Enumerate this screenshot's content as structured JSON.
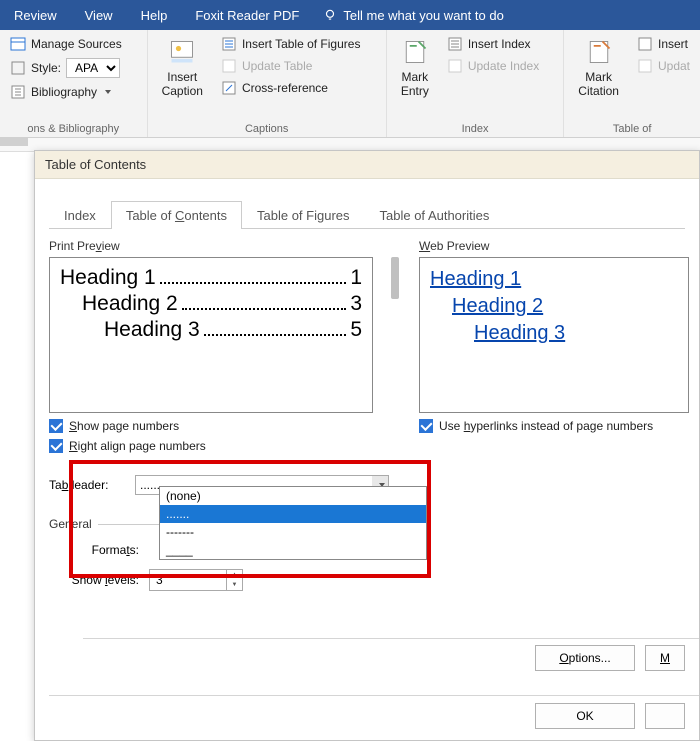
{
  "menu": {
    "review": "Review",
    "view": "View",
    "help": "Help",
    "foxit": "Foxit Reader PDF",
    "tell_me": "Tell me what you want to do"
  },
  "ribbon": {
    "group_cit_bib": {
      "manage_sources": "Manage Sources",
      "style_label": "Style:",
      "style_value": "APA",
      "bibliography": "Bibliography",
      "label": "ons & Bibliography"
    },
    "group_captions": {
      "insert_caption": "Insert\nCaption",
      "insert_tof": "Insert Table of Figures",
      "update_table": "Update Table",
      "cross_reference": "Cross-reference",
      "label": "Captions"
    },
    "group_index": {
      "mark_entry": "Mark\nEntry",
      "insert_index": "Insert Index",
      "update_index": "Update Index",
      "label": "Index"
    },
    "group_toa": {
      "mark_citation": "Mark\nCitation",
      "insert": "Insert",
      "updat": "Updat",
      "label": "Table of"
    }
  },
  "dialog": {
    "title": "Table of Contents",
    "tabs": {
      "index": "Index",
      "toc": "Table of Contents",
      "tof": "Table of Figures",
      "toa": "Table of Authorities"
    },
    "print_preview_label": "Print Preview",
    "web_preview_label": "Web Preview",
    "print_preview": [
      {
        "label": "Heading 1",
        "page": "1",
        "indent": "pl1"
      },
      {
        "label": "Heading 2",
        "page": "3",
        "indent": "pl2"
      },
      {
        "label": "Heading 3",
        "page": "5",
        "indent": "pl3"
      }
    ],
    "web_preview": [
      {
        "label": "Heading 1",
        "indent": ""
      },
      {
        "label": "Heading 2",
        "indent": "wpl2"
      },
      {
        "label": "Heading 3",
        "indent": "wpl3"
      }
    ],
    "show_page_numbers": "Show page numbers",
    "right_align": "Right align page numbers",
    "use_hyperlinks": "Use hyperlinks instead of page numbers",
    "tab_leader": "Tab leader:",
    "tab_leader_value": ".......",
    "tab_leader_options": [
      "(none)",
      ".......",
      "-------",
      "____"
    ],
    "general": "General",
    "formats": "Formats:",
    "show_levels": "Show levels:",
    "show_levels_value": "3",
    "options_btn": "Options...",
    "m_btn": "M",
    "ok_btn": "OK"
  }
}
